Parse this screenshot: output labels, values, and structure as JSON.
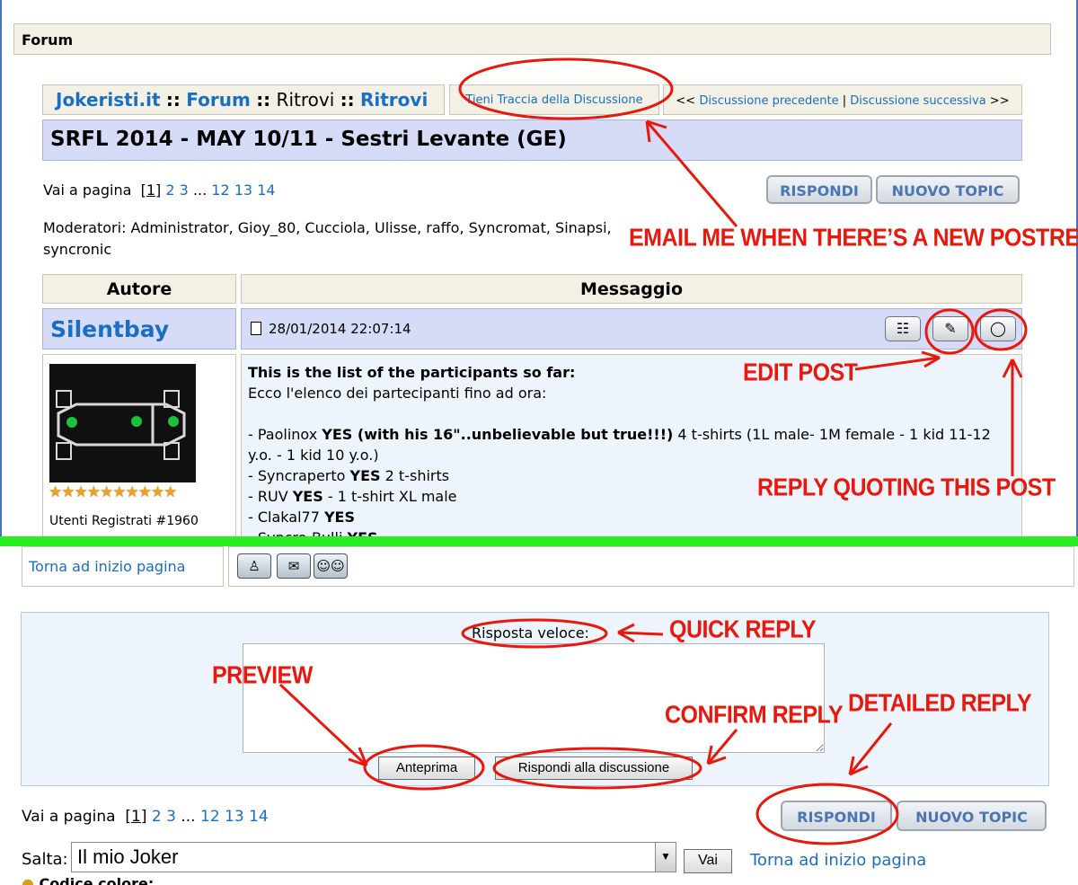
{
  "header": {
    "forum_label": "Forum"
  },
  "breadcrumb": {
    "site": "Jokeristi.it",
    "forum": "Forum",
    "section": "Ritrovi",
    "subsection": "Ritrovi",
    "separator": "::"
  },
  "topic_actions": {
    "track": "Tieni Traccia della Discussione",
    "prev_prefix": "<< ",
    "prev": "Discussione precedente",
    "divider": " | ",
    "next": "Discussione successiva",
    "next_suffix": " >>"
  },
  "topic_title": "SRFL 2014 - MAY 10/11 - Sestri Levante (GE)",
  "pagination": {
    "label": "Vai a pagina",
    "current": "[1]",
    "pages": [
      "2",
      "3"
    ],
    "ellipsis": "...",
    "last_pages": [
      "12",
      "13",
      "14"
    ]
  },
  "buttons": {
    "reply": "RISPONDI",
    "new_topic": "NUOVO TOPIC"
  },
  "moderators": "Moderatori: Administrator, Gioy_80, Cucciola, Ulisse, raffo, Syncromat, Sinapsi, syncronic",
  "table_headers": {
    "author": "Autore",
    "message": "Messaggio"
  },
  "post": {
    "author": "Silentbay",
    "date": "28/01/2014 22:07:14",
    "stars": "★★★★★★★★★★",
    "rank": "Utenti Registrati #1960",
    "line1": "This is the list of the participants so far:",
    "line2": "Ecco l'elenco dei partecipanti fino ad ora:",
    "entries": [
      {
        "prefix": "- Paolinox ",
        "bold": "YES (with his 16\"..unbelievable but true!!!)",
        "suffix": " 4 t-shirts (1L male- 1M female - 1 kid 11-12 y.o. - 1 kid 10 y.o.)"
      },
      {
        "prefix": "- Syncraperto ",
        "bold": "YES",
        "suffix": " 2 t-shirts"
      },
      {
        "prefix": "- RUV ",
        "bold": "YES",
        "suffix": " - 1 t-shirt XL male"
      },
      {
        "prefix": "- Clakal77 ",
        "bold": "YES",
        "suffix": ""
      },
      {
        "prefix": "- Syncro-Bulli ",
        "bold": "YES",
        "suffix": ""
      }
    ]
  },
  "post_footer": {
    "back_to_top": "Torna ad inizio pagina"
  },
  "quick_reply": {
    "label": "Risposta veloce:",
    "preview": "Anteprima",
    "submit": "Rispondi alla discussione",
    "text_value": ""
  },
  "jump": {
    "label": "Salta:",
    "selected": "Il mio Joker",
    "go": "Vai",
    "back_to_top": "Torna ad inizio pagina"
  },
  "footer_partial": "Codice colore:",
  "annotations": {
    "email": "EMAIL ME WHEN THERE’S A NEW POSTREPLY",
    "edit": "EDIT POST",
    "quote": "REPLY QUOTING THIS POST",
    "quick": "QUICK REPLY",
    "preview": "PREVIEW",
    "confirm": "CONFIRM REPLY",
    "detailed": "DETAILED REPLY"
  },
  "colors": {
    "link": "#1a6ec4",
    "header_bg": "#f3f1e6",
    "title_bg": "#d6dcf7",
    "annotation": "#e8180c",
    "divider": "#28f020"
  },
  "icons": [
    "document-icon",
    "profile-icon",
    "edit-icon",
    "quote-icon",
    "ip-icon",
    "email-icon",
    "buddy-icon",
    "joker-avatar"
  ]
}
